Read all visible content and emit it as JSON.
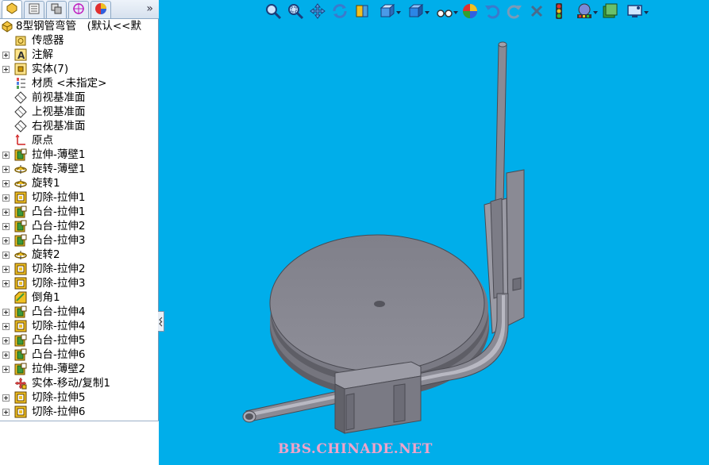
{
  "tree": {
    "root_label": "8型钢管弯管　(默认<<默",
    "items": [
      {
        "label": "传感器",
        "icon": "sensor-icon",
        "expandable": false
      },
      {
        "label": "注解",
        "icon": "annotation-icon",
        "expandable": true
      },
      {
        "label": "实体(7)",
        "icon": "solid-bodies-icon",
        "expandable": true
      },
      {
        "label": "材质 <未指定>",
        "icon": "material-icon",
        "expandable": false
      },
      {
        "label": "前视基准面",
        "icon": "plane-icon",
        "expandable": false
      },
      {
        "label": "上视基准面",
        "icon": "plane-icon",
        "expandable": false
      },
      {
        "label": "右视基准面",
        "icon": "plane-icon",
        "expandable": false
      },
      {
        "label": "原点",
        "icon": "origin-icon",
        "expandable": false
      },
      {
        "label": "拉伸-薄壁1",
        "icon": "extrude-icon",
        "expandable": true
      },
      {
        "label": "旋转-薄壁1",
        "icon": "revolve-icon",
        "expandable": true
      },
      {
        "label": "旋转1",
        "icon": "revolve-icon",
        "expandable": true
      },
      {
        "label": "切除-拉伸1",
        "icon": "cut-extrude-icon",
        "expandable": true
      },
      {
        "label": "凸台-拉伸1",
        "icon": "extrude-icon",
        "expandable": true
      },
      {
        "label": "凸台-拉伸2",
        "icon": "extrude-icon",
        "expandable": true
      },
      {
        "label": "凸台-拉伸3",
        "icon": "extrude-icon",
        "expandable": true
      },
      {
        "label": "旋转2",
        "icon": "revolve-icon",
        "expandable": true
      },
      {
        "label": "切除-拉伸2",
        "icon": "cut-extrude-icon",
        "expandable": true
      },
      {
        "label": "切除-拉伸3",
        "icon": "cut-extrude-icon",
        "expandable": true
      },
      {
        "label": "倒角1",
        "icon": "chamfer-icon",
        "expandable": false
      },
      {
        "label": "凸台-拉伸4",
        "icon": "extrude-icon",
        "expandable": true
      },
      {
        "label": "切除-拉伸4",
        "icon": "cut-extrude-icon",
        "expandable": true
      },
      {
        "label": "凸台-拉伸5",
        "icon": "extrude-icon",
        "expandable": true
      },
      {
        "label": "凸台-拉伸6",
        "icon": "extrude-icon",
        "expandable": true
      },
      {
        "label": "拉伸-薄壁2",
        "icon": "extrude-icon",
        "expandable": true
      },
      {
        "label": "实体-移动/复制1",
        "icon": "move-copy-icon",
        "expandable": false
      },
      {
        "label": "切除-拉伸5",
        "icon": "cut-extrude-icon",
        "expandable": true
      },
      {
        "label": "切除-拉伸6",
        "icon": "cut-extrude-icon",
        "expandable": true
      }
    ]
  },
  "panel_tabs": [
    {
      "icon": "feature-manager-icon"
    },
    {
      "icon": "property-manager-icon"
    },
    {
      "icon": "configuration-manager-icon"
    },
    {
      "icon": "dimxpert-icon"
    },
    {
      "icon": "display-manager-icon"
    }
  ],
  "tabs_more_label": "»",
  "toolbar": [
    {
      "icon": "zoom-to-fit-icon",
      "dropdown": false
    },
    {
      "icon": "zoom-to-area-icon",
      "dropdown": false
    },
    {
      "icon": "pan-icon",
      "dropdown": false
    },
    {
      "icon": "rotate-view-icon",
      "dropdown": false
    },
    {
      "icon": "section-view-icon",
      "dropdown": false
    },
    {
      "icon": "view-orientation-icon",
      "dropdown": true
    },
    {
      "icon": "display-style-icon",
      "dropdown": true
    },
    {
      "icon": "hide-show-items-icon",
      "dropdown": true
    },
    {
      "icon": "edit-appearance-icon",
      "dropdown": false
    },
    {
      "icon": "undo-icon",
      "dropdown": false
    },
    {
      "icon": "redo-icon",
      "dropdown": false
    },
    {
      "icon": "cancel-icon",
      "dropdown": false
    },
    {
      "icon": "rebuild-icon",
      "dropdown": false
    },
    {
      "icon": "apply-scene-icon",
      "dropdown": true
    },
    {
      "icon": "view-settings-icon",
      "dropdown": false
    },
    {
      "icon": "screen-capture-icon",
      "dropdown": true
    }
  ],
  "colors": {
    "viewport_bg": "#00aeea",
    "model_gray": "#8c8c96",
    "watermark": "#f1a3c9"
  },
  "watermark": "BBS.CHINADE.NET"
}
